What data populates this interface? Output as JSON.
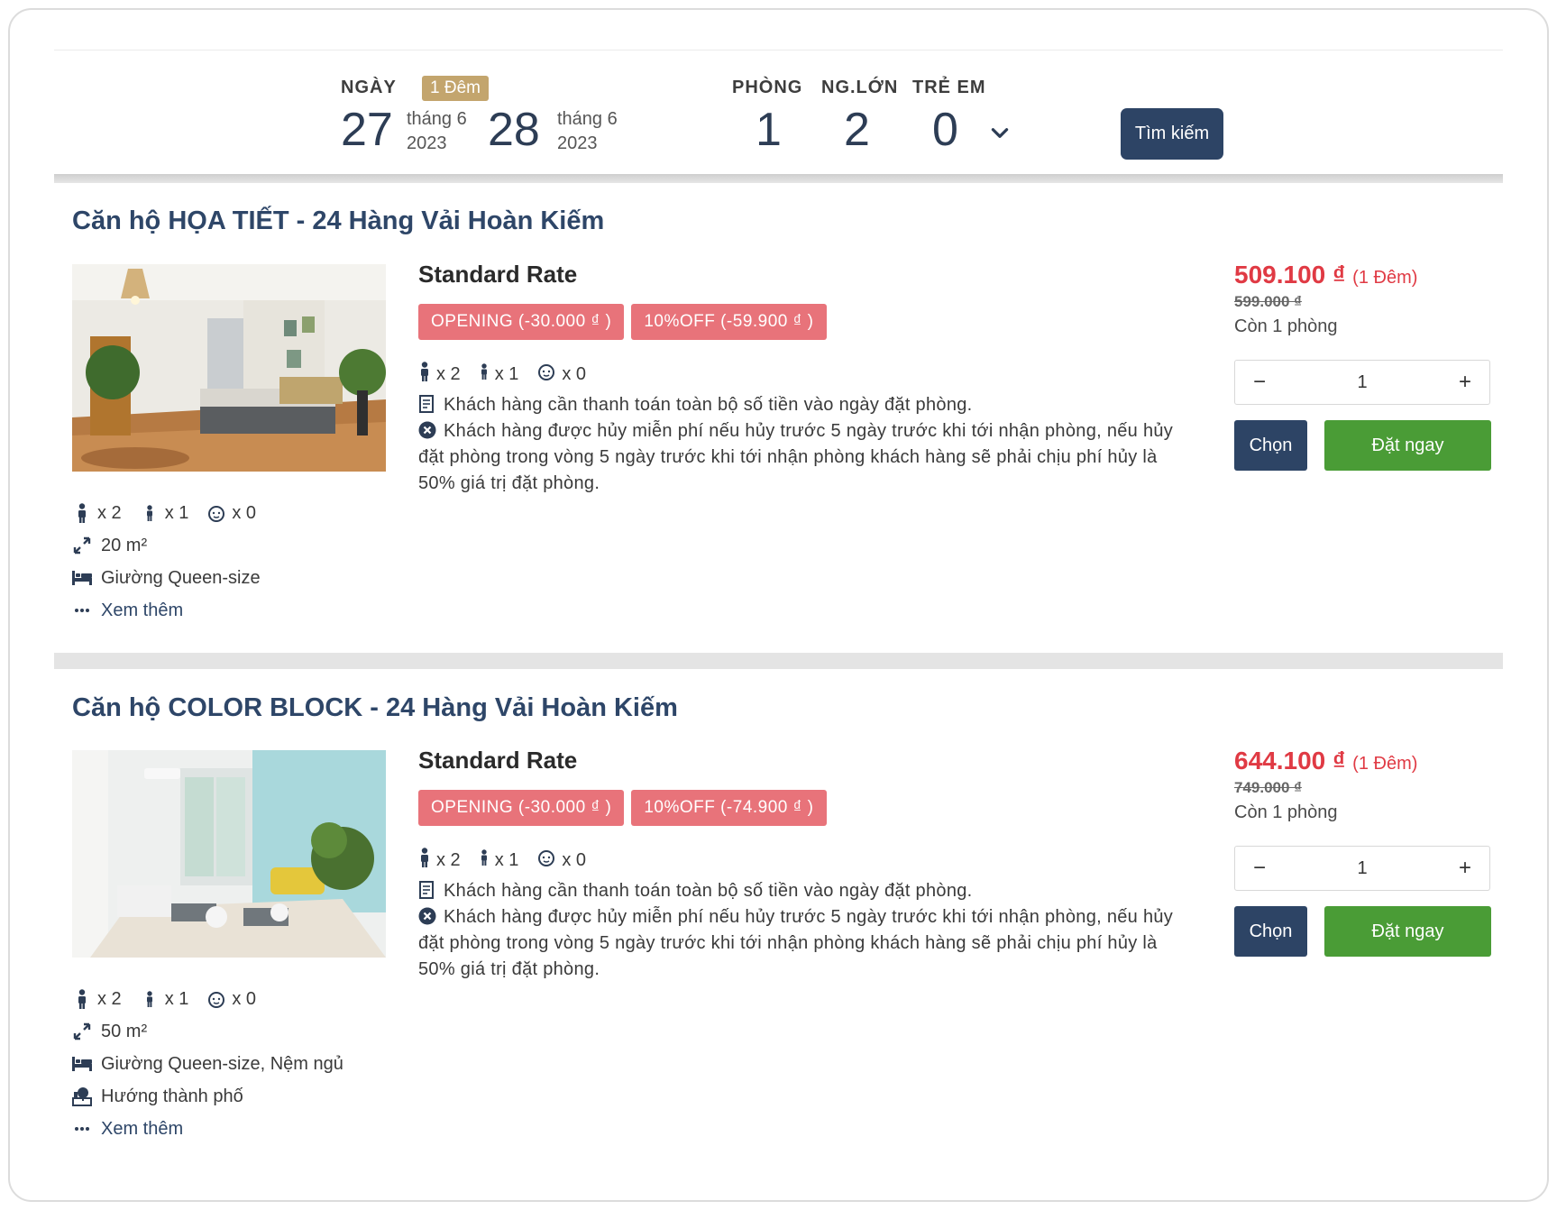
{
  "search": {
    "date_label": "NGÀY",
    "nights_badge": "1 Đêm",
    "checkin_day": "27",
    "checkin_month": "tháng 6",
    "checkin_year": "2023",
    "checkout_day": "28",
    "checkout_month": "tháng 6",
    "checkout_year": "2023",
    "rooms_label": "PHÒNG",
    "adults_label": "NG.LỚN",
    "children_label": "TRẺ EM",
    "rooms_value": "1",
    "adults_value": "2",
    "children_value": "0",
    "search_button": "Tìm kiếm"
  },
  "rooms": [
    {
      "title": "Căn hộ HỌA TIẾT - 24 Hàng Vải Hoàn Kiếm",
      "adults": "x 2",
      "kids": "x 1",
      "infants": "x 0",
      "area": "20 m²",
      "bed": "Giường Queen-size",
      "view": "",
      "see_more": "Xem thêm",
      "rate_name": "Standard Rate",
      "badge_1": "OPENING (-30.000 ₫ )",
      "badge_2": "10%OFF (-59.900 ₫ )",
      "rate_adults": "x 2",
      "rate_kids": "x 1",
      "rate_infants": "x 0",
      "payment_policy": "Khách hàng cần thanh toán toàn bộ số tiền vào ngày đặt phòng.",
      "cancel_policy": "Khách hàng được hủy miễn phí nếu hủy trước 5 ngày trước khi tới nhận phòng, nếu hủy đặt phòng trong vòng 5 ngày trước khi tới nhận phòng khách hàng sẽ phải chịu phí hủy là 50% giá trị đặt phòng.",
      "price": "509.100 ₫",
      "price_per": "(1 Đêm)",
      "old_price": "599.000 ₫",
      "remaining": "Còn 1 phòng",
      "qty_minus": "−",
      "qty": "1",
      "qty_plus": "+",
      "select_button": "Chọn",
      "book_button": "Đặt ngay"
    },
    {
      "title": "Căn hộ COLOR BLOCK - 24 Hàng Vải Hoàn Kiếm",
      "adults": "x 2",
      "kids": "x 1",
      "infants": "x 0",
      "area": "50 m²",
      "bed": "Giường Queen-size, Nệm ngủ",
      "view": "Hướng thành phố",
      "see_more": "Xem thêm",
      "rate_name": "Standard Rate",
      "badge_1": "OPENING (-30.000 ₫ )",
      "badge_2": "10%OFF (-74.900 ₫ )",
      "rate_adults": "x 2",
      "rate_kids": "x 1",
      "rate_infants": "x 0",
      "payment_policy": "Khách hàng cần thanh toán toàn bộ số tiền vào ngày đặt phòng.",
      "cancel_policy": "Khách hàng được hủy miễn phí nếu hủy trước 5 ngày trước khi tới nhận phòng, nếu hủy đặt phòng trong vòng 5 ngày trước khi tới nhận phòng khách hàng sẽ phải chịu phí hủy là 50% giá trị đặt phòng.",
      "price": "644.100 ₫",
      "price_per": "(1 Đêm)",
      "old_price": "749.000 ₫",
      "remaining": "Còn 1 phòng",
      "qty_minus": "−",
      "qty": "1",
      "qty_plus": "+",
      "select_button": "Chọn",
      "book_button": "Đặt ngay"
    }
  ],
  "colors": {
    "navy": "#2d4465",
    "title": "#2e4668",
    "price_red": "#e03a44",
    "badge_red": "#e8737a",
    "book_green": "#4a9c36",
    "night_gold": "#c3a56d"
  },
  "icons": [
    "adult-icon",
    "child-icon",
    "infant-icon",
    "area-icon",
    "bed-icon",
    "view-icon",
    "more-icon",
    "receipt-icon",
    "cancel-icon",
    "chevron-down-icon"
  ]
}
